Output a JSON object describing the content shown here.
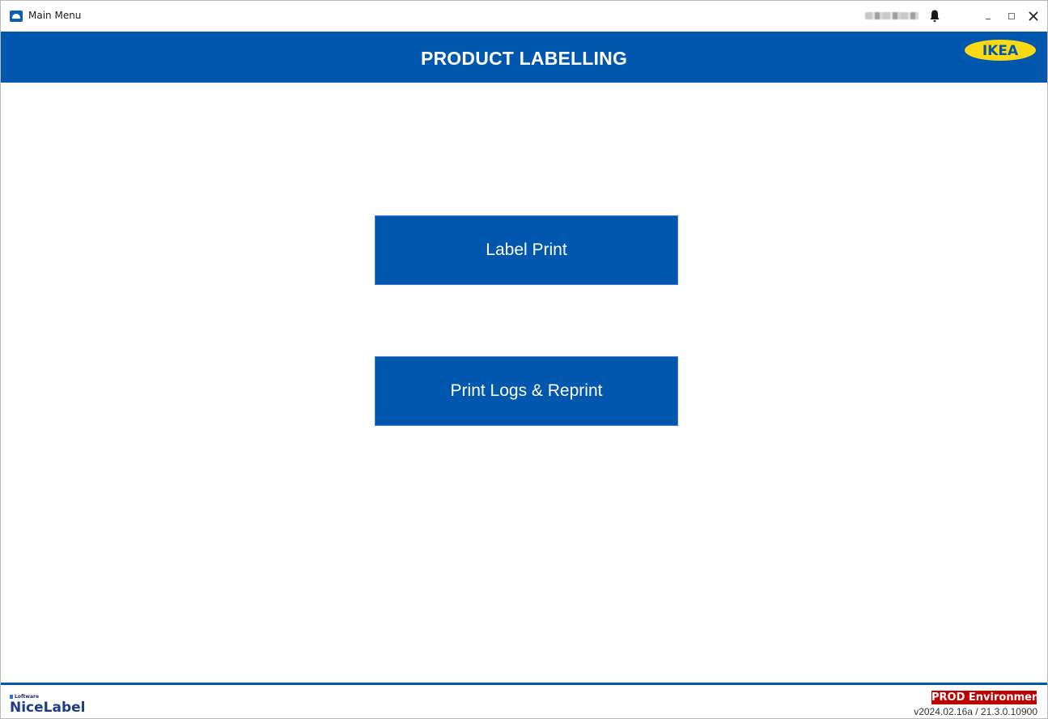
{
  "window": {
    "title": "Main Menu",
    "user_name_blurred": "",
    "icons": [
      "app-icon",
      "bell-icon",
      "minimize-icon",
      "maximize-icon",
      "close-icon"
    ]
  },
  "header": {
    "title": "PRODUCT LABELLING",
    "logo_text": "IKEA",
    "background_color": "#0057ad"
  },
  "menu": {
    "buttons": [
      {
        "label": "Label Print"
      },
      {
        "label": "Print Logs & Reprint"
      }
    ],
    "button_color": "#0057ad"
  },
  "footer": {
    "brand_small": "Loftware",
    "brand_big": "NiceLabel",
    "environment": "PROD Environment",
    "environment_color": "#c00000",
    "version": "v2024.02.16a / 21.3.0.10900"
  }
}
